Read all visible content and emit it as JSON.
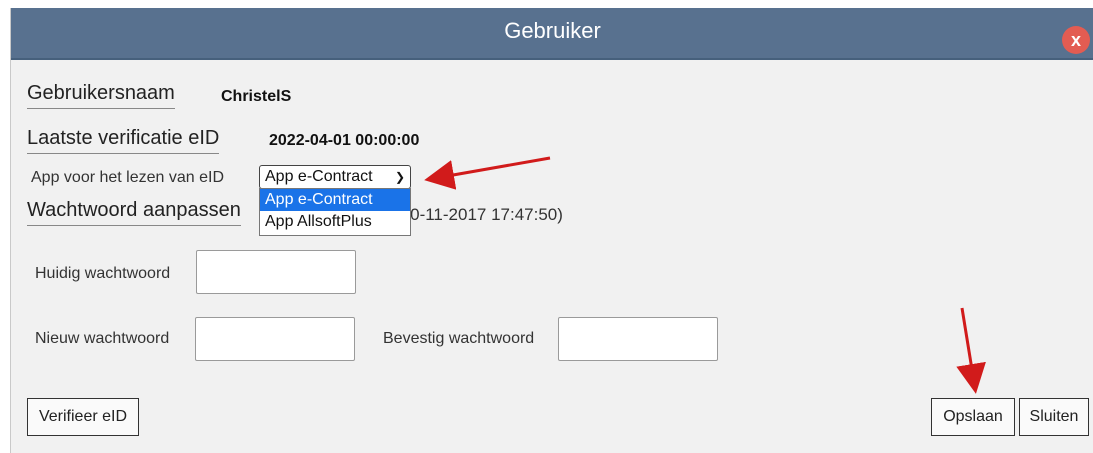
{
  "dialog": {
    "title": "Gebruiker",
    "close_label": "x"
  },
  "fields": {
    "username_label": "Gebruikersnaam",
    "username_value": "ChristelS",
    "verification_label": "Laatste verificatie eID",
    "verification_value": "2022-04-01 00:00:00",
    "app_label": "App voor het lezen van eID",
    "app_selected": "App e-Contract",
    "app_options": [
      "App e-Contract",
      "App AllsoftPlus"
    ],
    "password_change_label": "Wachtwoord aanpassen",
    "password_change_date": "(10-11-2017 17:47:50)",
    "current_password_label": "Huidig wachtwoord",
    "new_password_label": "Nieuw wachtwoord",
    "confirm_password_label": "Bevestig wachtwoord"
  },
  "buttons": {
    "verify": "Verifieer eID",
    "save": "Opslaan",
    "close": "Sluiten"
  },
  "colors": {
    "titlebar": "#58718f",
    "close_button": "#e35c52",
    "selected_option": "#1a73e8",
    "annotation_arrow": "#d11b1b"
  }
}
